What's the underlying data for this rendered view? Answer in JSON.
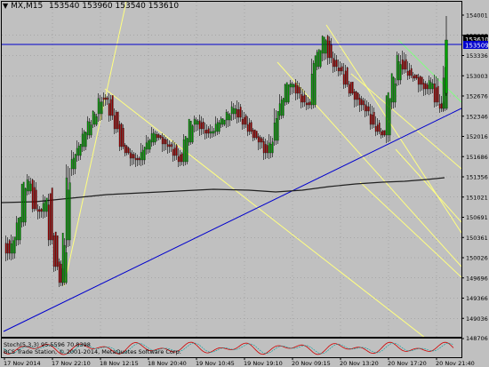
{
  "header": {
    "dropdown_glyph": "▼",
    "symbol": "MX,M15",
    "open": "153540",
    "high": "153960",
    "low": "153540",
    "close": "153610"
  },
  "price_axis": {
    "ticks": [
      "154001",
      "153668",
      "153336",
      "153003",
      "152676",
      "152346",
      "152016",
      "151686",
      "151356",
      "151021",
      "150691",
      "150361",
      "150026",
      "149696",
      "149366",
      "149036",
      "148706"
    ]
  },
  "price_labels": {
    "current": "153610",
    "horizontal_line": "153509",
    "current_color": "#000000",
    "hline_color": "#0000cd"
  },
  "time_axis": {
    "labels": [
      "17 Nov 2014",
      "17 Nov 22:10",
      "18 Nov 12:15",
      "18 Nov 20:40",
      "19 Nov 10:45",
      "19 Nov 19:10",
      "20 Nov 09:15",
      "20 Nov 13:20",
      "20 Nov 17:20",
      "20 Nov 21:40"
    ]
  },
  "indicator": {
    "label": "Stoch(5,3,3) 95.5596 70.8398"
  },
  "copyright": "BCS Trade Station, © 2001-2014, MetaQuotes Software Corp.",
  "colors": {
    "background": "#c0c0c0",
    "bull_candle": "#00a000",
    "bear_candle": "#a00000",
    "moving_average": "#202020",
    "trend_line": "#0000cd",
    "fib_lines": "#ffff80",
    "green_line": "#80ff80",
    "stoch_main": "#d00000",
    "grid": "#8c8c8c"
  }
}
